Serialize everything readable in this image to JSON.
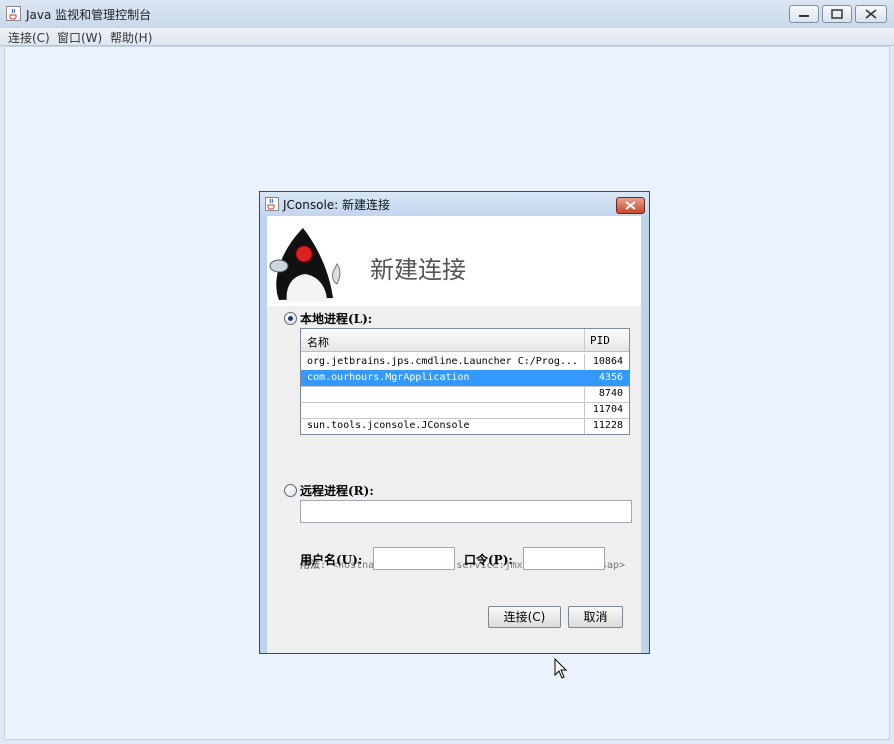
{
  "window": {
    "title": "Java 监视和管理控制台"
  },
  "menu": [
    {
      "label": "连接(C)"
    },
    {
      "label": "窗口(W)"
    },
    {
      "label": "帮助(H)"
    }
  ],
  "dialog": {
    "title": "JConsole: 新建连接",
    "banner_title": "新建连接",
    "local": {
      "label": "本地进程(L):",
      "selected": true,
      "columns": [
        "名称",
        "PID"
      ],
      "rows": [
        {
          "name": "org.jetbrains.jps.cmdline.Launcher C:/Prog...",
          "pid": "10864",
          "selected": false
        },
        {
          "name": "com.ourhours.MgrApplication",
          "pid": "4356",
          "selected": true
        },
        {
          "name": "",
          "pid": "8740",
          "selected": false
        },
        {
          "name": "",
          "pid": "11704",
          "selected": false
        },
        {
          "name": "sun.tools.jconsole.JConsole",
          "pid": "11228",
          "selected": false
        }
      ]
    },
    "remote": {
      "label": "远程进程(R):",
      "selected": false,
      "value": "",
      "usage_label": "用法",
      "usage_text": ": <hostname>:<port> 或 service:jmx:<protocol>:<sap>"
    },
    "username_label": "用户名(U):",
    "username_value": "",
    "password_label": "口令(P):",
    "password_value": "",
    "connect_label": "连接(C)",
    "cancel_label": "取消"
  },
  "colors": {
    "selection": "#3399ff",
    "desktop": "#eaf3fd"
  }
}
